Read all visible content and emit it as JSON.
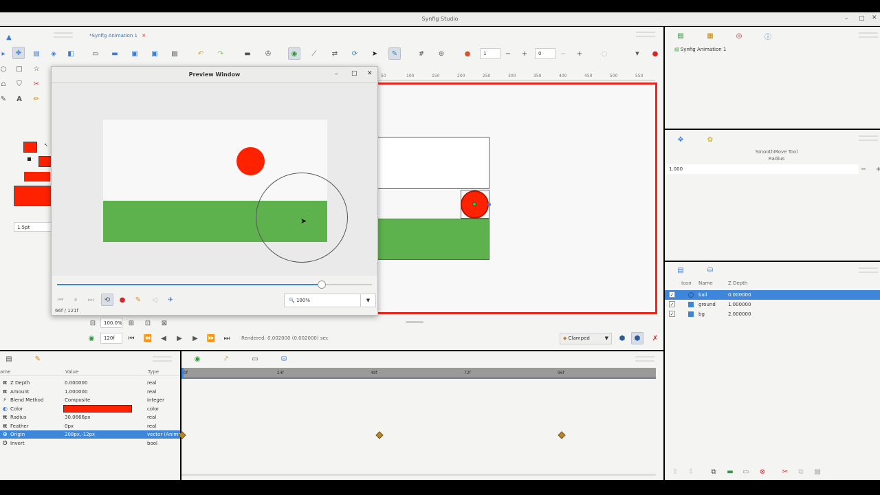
{
  "app": {
    "title": "Synfig Studio"
  },
  "document_tab": {
    "label": "*Synfig Animation 1",
    "close": "✕"
  },
  "toolbar": {
    "frame_value": "1",
    "offset_value": "0",
    "minus": "−",
    "plus": "+"
  },
  "ruler": {
    "ticks": [
      "50",
      "100",
      "150",
      "200",
      "250",
      "300",
      "350",
      "400",
      "450",
      "500",
      "550"
    ]
  },
  "preview": {
    "title": "Preview Window",
    "zoom_value": "100%",
    "frame_info": "66f  /  121f",
    "progress": 0.84,
    "controls": {
      "minimize": "–",
      "maximize": "□",
      "close": "✕",
      "dropdown": "▼"
    }
  },
  "toolbox": {
    "width_value": "1.5pt"
  },
  "canvas_bottom": {
    "zoom": "100.0%",
    "end_time": "120f",
    "render_status": "Rendered: 0.002000 (0.002000) sec",
    "interpolation": "Clamped"
  },
  "canvas_browser": {
    "item": "Synfig Animation 1"
  },
  "tool_options": {
    "tool_name": "SmoothMove Tool",
    "param_label": "Radius",
    "param_value": "1.000",
    "minus": "−",
    "plus": "+"
  },
  "layers": {
    "headers": [
      "Icon",
      "Name",
      "Z Depth"
    ],
    "rows": [
      {
        "name": "ball",
        "z": "0.000000",
        "selected": true
      },
      {
        "name": "ground",
        "z": "1.000000",
        "selected": false
      },
      {
        "name": "bg",
        "z": "2.000000",
        "selected": false
      }
    ]
  },
  "params": {
    "headers": [
      "ame",
      "Value",
      "Type"
    ],
    "rows": [
      {
        "name": "Z Depth",
        "value": "0.000000",
        "type": "real",
        "icon": "pi"
      },
      {
        "name": "Amount",
        "value": "1.000000",
        "type": "real",
        "icon": "pi"
      },
      {
        "name": "Blend Method",
        "value": "Composite",
        "type": "integer",
        "icon": "blend"
      },
      {
        "name": "Color",
        "value": "",
        "type": "color",
        "icon": "color"
      },
      {
        "name": "Radius",
        "value": "30.0666px",
        "type": "real",
        "icon": "pi"
      },
      {
        "name": "Feather",
        "value": "0px",
        "type": "real",
        "icon": "pi"
      },
      {
        "name": "Origin",
        "value": "208px,-12px",
        "type": "vector (Anima",
        "icon": "origin"
      },
      {
        "name": "Invert",
        "value": "",
        "type": "bool",
        "icon": "power"
      }
    ]
  },
  "timetrack": {
    "labels": [
      "0f",
      "24f",
      "48f",
      "72f",
      "96f"
    ]
  },
  "colors": {
    "ball_red": "#ff2200",
    "ground_green": "#5db24d",
    "selection_blue": "#3d86d9",
    "canvas_border": "#e8281e",
    "keyframe": "#b5852c"
  }
}
